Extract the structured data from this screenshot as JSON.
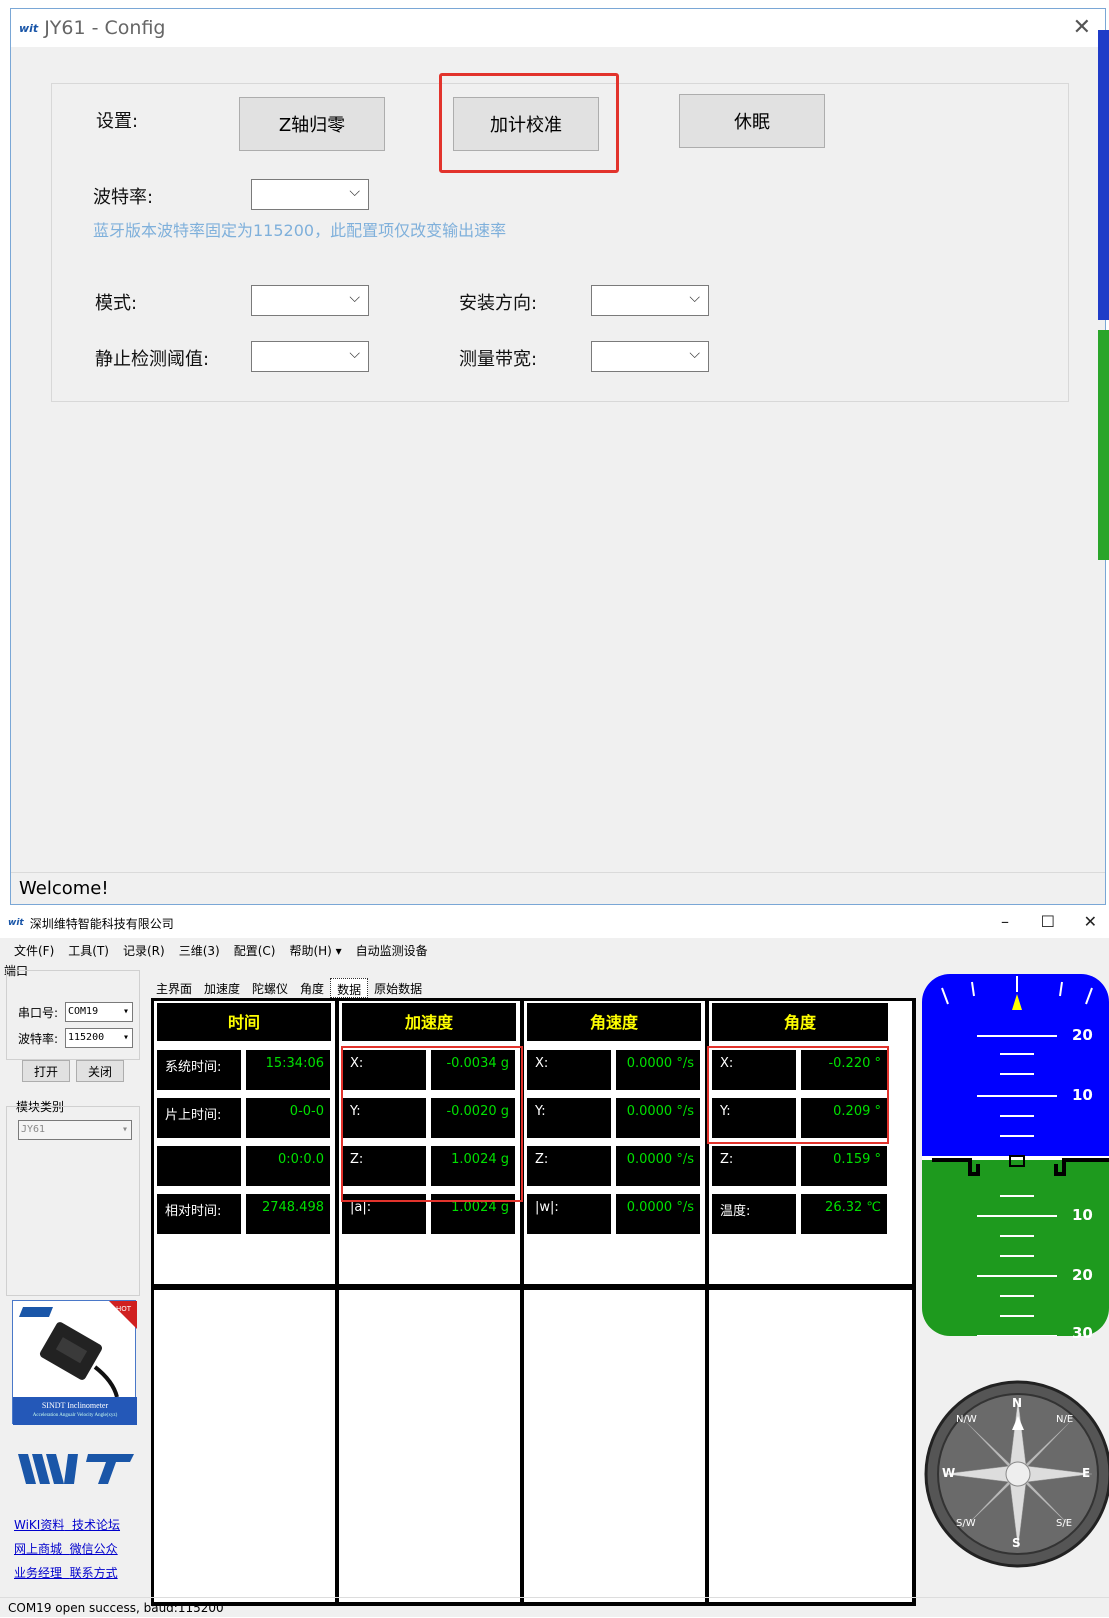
{
  "config_window": {
    "logo": "wit",
    "title": "JY61 - Config",
    "settings_label": "设置:",
    "z_zero_button": "Z轴归零",
    "accel_calib_button": "加计校准",
    "sleep_button": "休眠",
    "baud_label": "波特率:",
    "bluetooth_hint": "蓝牙版本波特率固定为115200，此配置项仅改变输出速率",
    "mode_label": "模式:",
    "install_dir_label": "安装方向:",
    "static_threshold_label": "静止检测阈值:",
    "bandwidth_label": "测量带宽:",
    "status": "Welcome!"
  },
  "main_window": {
    "logo": "wit",
    "title": "深圳维特智能科技有限公司",
    "menu": [
      "文件(F)",
      "工具(T)",
      "记录(R)",
      "三维(3)",
      "配置(C)",
      "帮助(H) ▾",
      "自动监测设备"
    ],
    "port_group": "端口",
    "port_label": "串口号:",
    "port_value": "COM19",
    "baud_label": "波特率:",
    "baud_value": "115200",
    "open_button": "打开",
    "close_button": "关闭",
    "module_group": "模块类别",
    "module_value": "JY61",
    "product_caption": "SINDT Inclinometer",
    "product_sub": "Acceleration Angualr Velocity Angle(xyz)",
    "product_badge": "HOT",
    "brand_logo": "WIT",
    "links": [
      [
        "WiKI资料",
        "技术论坛"
      ],
      [
        "网上商城",
        "微信公众"
      ],
      [
        "业务经理",
        "联系方式"
      ]
    ],
    "tabs": [
      "主界面",
      "加速度",
      "陀螺仪",
      "角度",
      "数据",
      "原始数据"
    ],
    "active_tab": "数据",
    "columns": {
      "time": {
        "header": "时间",
        "rows": [
          {
            "label": "系统时间:",
            "value": "15:34:06"
          },
          {
            "label": "片上时间:",
            "value": "0-0-0"
          },
          {
            "label": "",
            "value": "0:0:0.0"
          },
          {
            "label": "相对时间:",
            "value": "2748.498"
          }
        ]
      },
      "accel": {
        "header": "加速度",
        "rows": [
          {
            "label": "X:",
            "value": "-0.0034 g"
          },
          {
            "label": "Y:",
            "value": "-0.0020 g"
          },
          {
            "label": "Z:",
            "value": "1.0024 g"
          },
          {
            "label": "|a|:",
            "value": "1.0024 g"
          }
        ]
      },
      "gyro": {
        "header": "角速度",
        "rows": [
          {
            "label": "X:",
            "value": "0.0000 °/s"
          },
          {
            "label": "Y:",
            "value": "0.0000 °/s"
          },
          {
            "label": "Z:",
            "value": "0.0000 °/s"
          },
          {
            "label": "|w|:",
            "value": "0.0000 °/s"
          }
        ]
      },
      "angle": {
        "header": "角度",
        "rows": [
          {
            "label": "X:",
            "value": "-0.220 °"
          },
          {
            "label": "Y:",
            "value": "0.209 °"
          },
          {
            "label": "Z:",
            "value": "0.159 °"
          },
          {
            "label": "温度:",
            "value": "26.32 ℃"
          }
        ]
      }
    },
    "attitude_scale": [
      "20",
      "10",
      "10",
      "20",
      "30"
    ],
    "compass": {
      "N": "N",
      "E": "E",
      "S": "S",
      "W": "W",
      "NE": "N/E",
      "NW": "N/W",
      "SE": "S/E",
      "SW": "S/W"
    },
    "status": "COM19 open success, baud:115200"
  },
  "colors": {
    "sky": "#0000ff",
    "ground": "#1e9a1e",
    "value_green": "#00e000",
    "header_yellow": "#ffff00",
    "highlight": "#e2332c"
  }
}
